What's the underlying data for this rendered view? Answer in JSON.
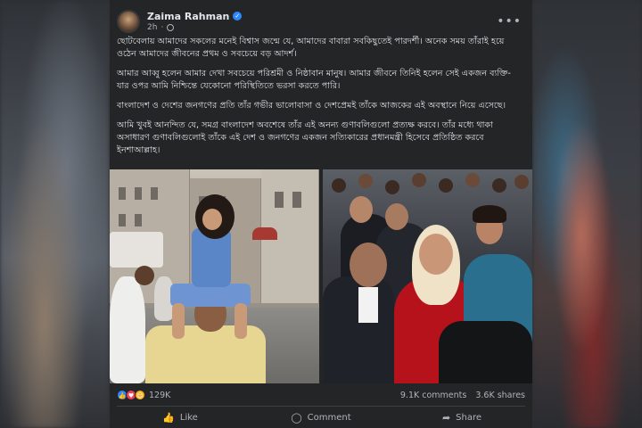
{
  "post": {
    "author": "Zaima Rahman",
    "time": "2h",
    "verified_icon": "verified-badge-icon",
    "privacy_icon": "globe-icon",
    "more_icon": "more-options-icon",
    "paragraphs": [
      "ছোটবেলায় আমাদের সকলের মনেই বিশ্বাস জন্মে যে, আমাদের বাবারা সবকিছুতেই পারদর্শী। অনেক সময় তাঁরাই হয়ে ওঠেন আমাদের জীবনের প্রথম ও সবচেয়ে বড় আদর্শ।",
      "আমার আব্বু হলেন আমার দেখা সবচেয়ে পরিশ্রমী ও নিষ্ঠাবান মানুষ। আমার জীবনে তিনিই হলেন সেই একজন ব্যক্তি- যার ওপর আমি নিশ্চিন্তে যেকোনো পরিস্থিতিতে ভরসা করতে পারি।",
      "বাংলাদেশ ও দেশের জনগণের প্রতি তাঁর গভীর ভালোবাসা ও দেশপ্রেমই তাঁকে আজকের এই অবস্থানে নিয়ে এসেছে।",
      "আমি খুবই আনন্দিত যে, সমগ্র বাংলাদেশ অবশেষে তাঁর এই অনন্য গুণাবলিগুলো প্রত্যক্ষ করবে। তাঁর মধ্যে থাকা অসাধারণ গুণাবলিগুলোই তাঁকে এই দেশ ও জনগণের একজন সত্যিকারের প্রধানমন্ত্রী হিসেবে প্রতিষ্ঠিত করবে ইনশাআল্লাহ।"
    ]
  },
  "reactions": {
    "icons": [
      "like-reaction-icon",
      "love-reaction-icon",
      "care-reaction-icon"
    ],
    "colors": {
      "like": "#2d88ff",
      "love": "#f33e58",
      "care": "#f7b125"
    },
    "count": "129K",
    "comments": "9.1K comments",
    "shares": "3.6K shares"
  },
  "actions": {
    "like": {
      "label": "Like",
      "icon": "thumbs-up-icon"
    },
    "comment": {
      "label": "Comment",
      "icon": "comment-bubble-icon"
    },
    "share": {
      "label": "Share",
      "icon": "share-arrow-icon"
    }
  },
  "colors": {
    "card_bg": "#242526",
    "text_primary": "#e4e6eb",
    "text_secondary": "#b0b3b8",
    "accent": "#2d88ff"
  }
}
